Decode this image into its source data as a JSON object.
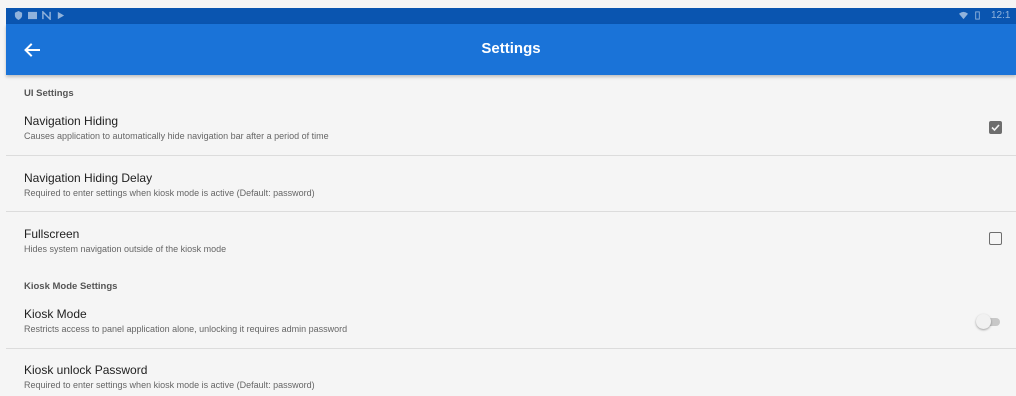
{
  "status_bar": {
    "time": "12:1"
  },
  "app_bar": {
    "title": "Settings",
    "back_icon": "arrow-left-icon"
  },
  "sections": [
    {
      "header": "UI Settings"
    },
    {
      "header": "Kiosk Mode Settings"
    }
  ],
  "preferences": {
    "navigation_hiding": {
      "title": "Navigation Hiding",
      "summary": "Causes application to automatically hide navigation bar after a period of time",
      "checked": true
    },
    "navigation_hiding_delay": {
      "title": "Navigation Hiding Delay",
      "summary": "Required to enter settings when kiosk mode is active (Default: password)"
    },
    "fullscreen": {
      "title": "Fullscreen",
      "summary": "Hides system navigation outside of the kiosk mode",
      "checked": false
    },
    "kiosk_mode": {
      "title": "Kiosk Mode",
      "summary": "Restricts access to panel application alone, unlocking it requires admin password",
      "enabled": false
    },
    "kiosk_unlock_password": {
      "title": "Kiosk unlock Password",
      "summary": "Required to enter settings when kiosk mode is active (Default: password)"
    }
  },
  "colors": {
    "app_bar": "#1a73d8",
    "status_bar": "#0a55b0",
    "background": "#f5f5f5"
  }
}
